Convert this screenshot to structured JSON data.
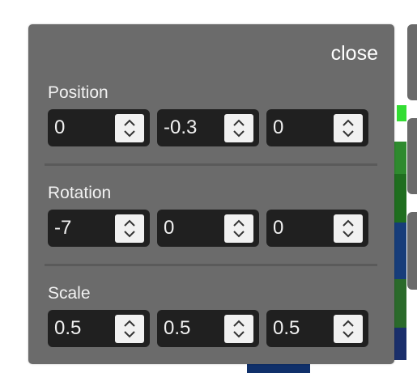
{
  "dialog": {
    "close_label": "close",
    "groups": [
      {
        "label": "Position",
        "values": [
          "0",
          "-0.3",
          "0"
        ]
      },
      {
        "label": "Rotation",
        "values": [
          "-7",
          "0",
          "0"
        ]
      },
      {
        "label": "Scale",
        "values": [
          "0.5",
          "0.5",
          "0.5"
        ]
      }
    ]
  },
  "icons": {
    "spinner": "chevron-up-down-icon"
  },
  "colors": {
    "panel": "#6b6b6b",
    "field": "#202020",
    "spinner": "#f1f1f1",
    "text": "#f0f0f0"
  }
}
